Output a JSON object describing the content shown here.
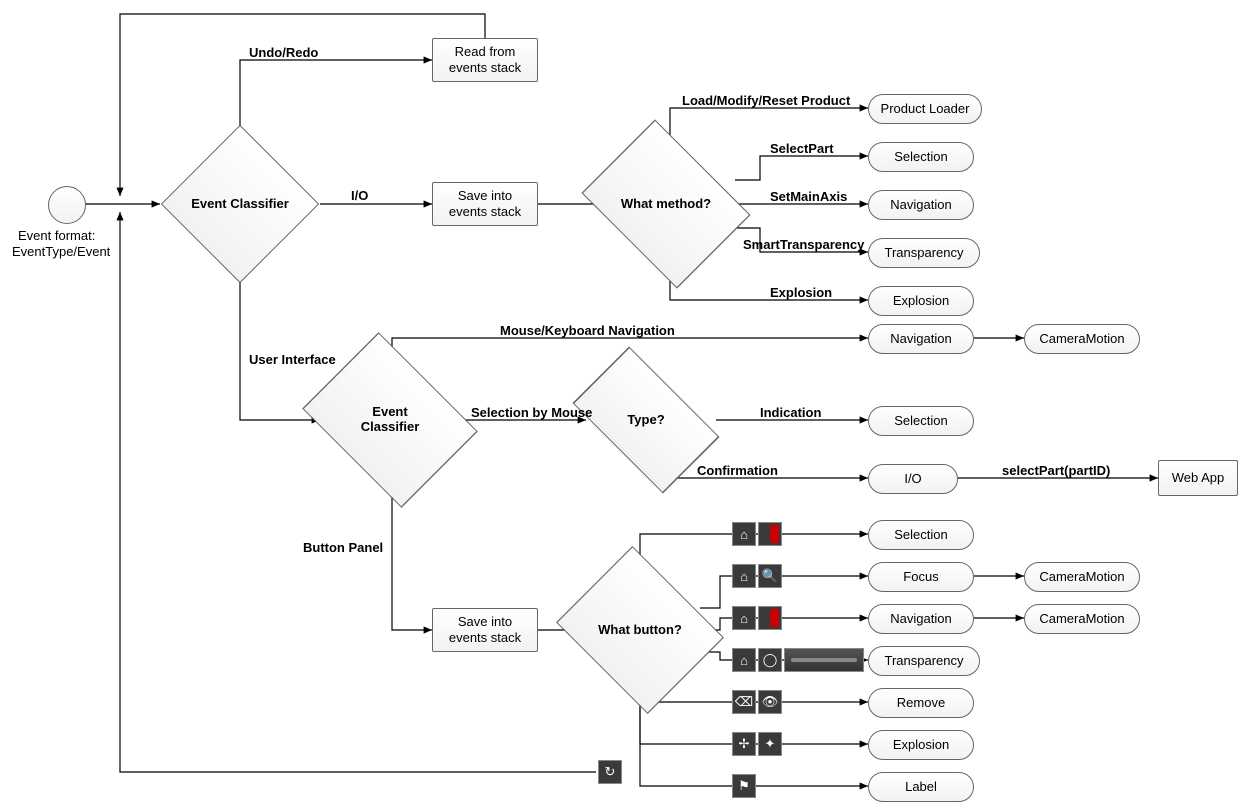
{
  "start": {
    "label1": "Event format:",
    "label2": "EventType/Event"
  },
  "classifier1": "Event Classifier",
  "classifier2": "Event Classifier",
  "decisionMethod": "What method?",
  "decisionType": "Type?",
  "decisionButton": "What button?",
  "boxes": {
    "readStack": "Read from\nevents stack",
    "saveStack1": "Save into\nevents stack",
    "saveStack2": "Save into\nevents stack",
    "webApp": "Web App"
  },
  "edges": {
    "undoRedo": "Undo/Redo",
    "io": "I/O",
    "userInterface": "User Interface",
    "loadModify": "Load/Modify/Reset Product",
    "selectPart": "SelectPart",
    "setMainAxis": "SetMainAxis",
    "smartTransparency": "SmartTransparency",
    "explosion": "Explosion",
    "mouseKeyNav": "Mouse/Keyboard Navigation",
    "selectionByMouse": "Selection by Mouse",
    "indication": "Indication",
    "confirmation": "Confirmation",
    "selectPartCall": "selectPart(partID)",
    "buttonPanel": "Button Panel"
  },
  "pills": {
    "productLoader": "Product Loader",
    "selection": "Selection",
    "navigation": "Navigation",
    "transparency": "Transparency",
    "explosion": "Explosion",
    "navigation2": "Navigation",
    "cameraMotion": "CameraMotion",
    "selection2": "Selection",
    "io": "I/O",
    "selection3": "Selection",
    "focus": "Focus",
    "navigation3": "Navigation",
    "transparency2": "Transparency",
    "remove": "Remove",
    "explosion2": "Explosion",
    "label": "Label",
    "cameraMotion2": "CameraMotion",
    "cameraMotion3": "CameraMotion"
  }
}
